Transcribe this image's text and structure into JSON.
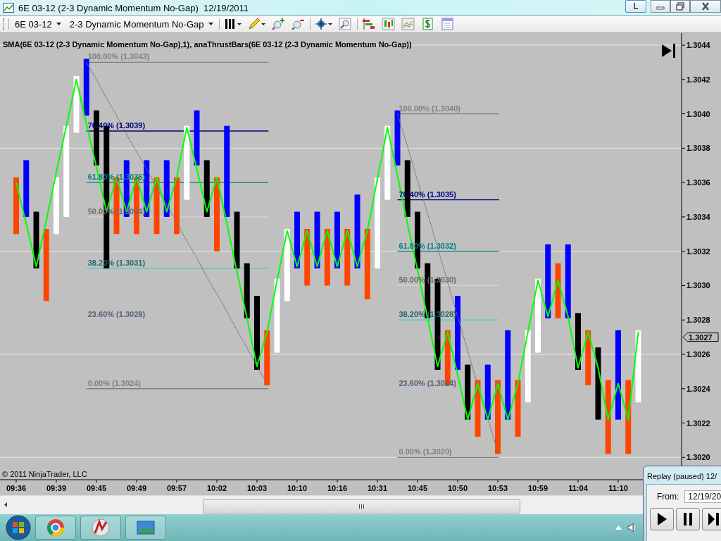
{
  "window": {
    "title": "6E 03-12 (2-3 Dynamic Momentum No-Gap)",
    "date": "12/19/2011",
    "layout_button": "L"
  },
  "toolbar": {
    "instrument": "6E 03-12",
    "bars_type": "2-3 Dynamic Momentum No-Gap"
  },
  "chart": {
    "legend": "SMA(6E 03-12 (2-3 Dynamic Momentum No-Gap),1), anaThrustBars(6E 03-12 (2-3 Dynamic Momentum No-Gap))",
    "copyright": "© 2011 NinjaTrader, LLC",
    "current_price": "1.3027",
    "chart_data": {
      "type": "candlestick",
      "grid": true,
      "ylim": [
        1.30187,
        1.30447
      ],
      "categories": [
        "09:36",
        null,
        null,
        null,
        "09:39",
        null,
        null,
        null,
        "09:45",
        null,
        null,
        null,
        "09:49",
        null,
        null,
        null,
        "09:57",
        null,
        null,
        null,
        "10:02",
        null,
        null,
        null,
        "10:03",
        null,
        null,
        null,
        "10:10",
        null,
        null,
        null,
        "10:16",
        null,
        null,
        null,
        "10:31",
        null,
        null,
        null,
        "10:45",
        null,
        null,
        null,
        "10:50",
        null,
        null,
        null,
        "10:53",
        null,
        null,
        null,
        "10:59",
        null,
        null,
        null,
        "11:04",
        null,
        null,
        null,
        "11:10",
        null,
        null
      ],
      "yticks": [
        {
          "value": 1.3044,
          "label": "1.3044"
        },
        {
          "value": 1.3042,
          "label": "1.3042"
        },
        {
          "value": 1.304,
          "label": "1.3040"
        },
        {
          "value": 1.3038,
          "label": "1.3038"
        },
        {
          "value": 1.3036,
          "label": "1.3036"
        },
        {
          "value": 1.3034,
          "label": "1.3034"
        },
        {
          "value": 1.3032,
          "label": "1.3032"
        },
        {
          "value": 1.303,
          "label": "1.3030"
        },
        {
          "value": 1.3028,
          "label": "1.3028"
        },
        {
          "value": 1.3026,
          "label": "1.3026"
        },
        {
          "value": 1.3024,
          "label": "1.3024"
        },
        {
          "value": 1.3022,
          "label": "1.3022"
        },
        {
          "value": 1.302,
          "label": "1.3020"
        }
      ],
      "series": [
        {
          "color": "#ff4500",
          "ohlc": [
            [
              1.30363,
              1.30363,
              1.3033,
              1.3033
            ],
            null,
            null,
            [
              1.30333,
              1.30333,
              1.30291,
              1.30291
            ],
            null,
            null,
            null,
            null,
            null,
            null,
            [
              1.30363,
              1.30363,
              1.3033,
              1.3033
            ],
            null,
            [
              1.30363,
              1.30363,
              1.3033,
              1.3033
            ],
            null,
            [
              1.30363,
              1.30363,
              1.3033,
              1.3033
            ],
            null,
            [
              1.30363,
              1.30363,
              1.3033,
              1.3033
            ],
            null,
            null,
            null,
            [
              1.30363,
              1.30363,
              1.3032,
              1.3032
            ],
            null,
            null,
            null,
            null,
            [
              1.30274,
              1.30274,
              1.30242,
              1.30242
            ],
            null,
            null,
            null,
            [
              1.30333,
              1.30333,
              1.303,
              1.303
            ],
            null,
            [
              1.30333,
              1.30333,
              1.303,
              1.303
            ],
            null,
            [
              1.30333,
              1.30333,
              1.303,
              1.303
            ],
            null,
            [
              1.30333,
              1.30333,
              1.30292,
              1.30292
            ],
            null,
            null,
            null,
            null,
            null,
            null,
            null,
            [
              1.30274,
              1.30274,
              1.30242,
              1.30242
            ],
            null,
            null,
            [
              1.30245,
              1.30245,
              1.30212,
              1.30212
            ],
            null,
            [
              1.30245,
              1.30245,
              1.30202,
              1.30202
            ],
            null,
            [
              1.30245,
              1.30245,
              1.30212,
              1.30212
            ],
            null,
            null,
            null,
            [
              1.30313,
              1.30313,
              1.30281,
              1.30281
            ],
            null,
            null,
            [
              1.30274,
              1.30274,
              1.30242,
              1.30242
            ],
            null,
            [
              1.30245,
              1.30245,
              1.30202,
              1.30202
            ],
            null,
            [
              1.30245,
              1.30245,
              1.30202,
              1.30202
            ],
            null
          ]
        },
        {
          "color": "#0000ff",
          "ohlc": [
            null,
            [
              1.3034,
              1.30373,
              1.3034,
              1.30373
            ],
            null,
            null,
            null,
            null,
            null,
            [
              1.30399,
              1.30432,
              1.30399,
              1.30432
            ],
            null,
            null,
            null,
            [
              1.3034,
              1.30373,
              1.3034,
              1.30373
            ],
            null,
            [
              1.3034,
              1.30373,
              1.3034,
              1.30373
            ],
            null,
            [
              1.3034,
              1.30373,
              1.3034,
              1.30373
            ],
            null,
            null,
            [
              1.3037,
              1.30402,
              1.3037,
              1.30402
            ],
            null,
            null,
            [
              1.3034,
              1.30393,
              1.3034,
              1.30393
            ],
            null,
            null,
            null,
            null,
            null,
            null,
            [
              1.3031,
              1.30343,
              1.3031,
              1.30343
            ],
            null,
            [
              1.3031,
              1.30343,
              1.3031,
              1.30343
            ],
            null,
            [
              1.3031,
              1.30343,
              1.3031,
              1.30343
            ],
            null,
            [
              1.3031,
              1.30353,
              1.3031,
              1.30353
            ],
            null,
            null,
            null,
            [
              1.3037,
              1.30402,
              1.3037,
              1.30402
            ],
            null,
            null,
            null,
            null,
            null,
            [
              1.30251,
              1.30294,
              1.30251,
              1.30294
            ],
            null,
            null,
            [
              1.30222,
              1.30254,
              1.30222,
              1.30254
            ],
            null,
            [
              1.30222,
              1.30274,
              1.30222,
              1.30274
            ],
            null,
            null,
            null,
            [
              1.30281,
              1.30324,
              1.30281,
              1.30324
            ],
            null,
            [
              1.30281,
              1.30324,
              1.30281,
              1.30324
            ],
            null,
            null,
            null,
            null,
            [
              1.30222,
              1.30274,
              1.30222,
              1.30274
            ],
            null,
            null
          ]
        },
        {
          "color": "#000000",
          "ohlc": [
            null,
            null,
            [
              1.30343,
              1.30343,
              1.3031,
              1.3031
            ],
            null,
            null,
            null,
            null,
            null,
            [
              1.30402,
              1.30402,
              1.3037,
              1.3037
            ],
            [
              1.30393,
              1.30393,
              1.3031,
              1.3031
            ],
            null,
            null,
            null,
            null,
            null,
            null,
            null,
            null,
            null,
            [
              1.30373,
              1.30373,
              1.3034,
              1.3034
            ],
            null,
            null,
            [
              1.30343,
              1.30343,
              1.3031,
              1.3031
            ],
            [
              1.30313,
              1.30313,
              1.30281,
              1.30281
            ],
            [
              1.30294,
              1.30294,
              1.30251,
              1.30251
            ],
            null,
            null,
            null,
            null,
            null,
            null,
            null,
            null,
            null,
            null,
            null,
            null,
            null,
            null,
            [
              1.30373,
              1.30373,
              1.3034,
              1.3034
            ],
            [
              1.30343,
              1.30343,
              1.3031,
              1.3031
            ],
            [
              1.30313,
              1.30313,
              1.30281,
              1.30281
            ],
            [
              1.30304,
              1.30304,
              1.30251,
              1.30251
            ],
            null,
            null,
            [
              1.30254,
              1.30254,
              1.30222,
              1.30222
            ],
            null,
            null,
            null,
            null,
            null,
            null,
            null,
            null,
            null,
            null,
            [
              1.30284,
              1.30284,
              1.30251,
              1.30251
            ],
            null,
            [
              1.30264,
              1.30264,
              1.30222,
              1.30222
            ],
            null,
            null,
            null,
            null
          ]
        },
        {
          "color": "#ffffff",
          "ohlc": [
            null,
            null,
            null,
            null,
            [
              1.3033,
              1.30363,
              1.3033,
              1.30363
            ],
            [
              1.3034,
              1.30393,
              1.3034,
              1.30393
            ],
            [
              1.30389,
              1.30422,
              1.30389,
              1.30422
            ],
            null,
            null,
            null,
            null,
            null,
            null,
            null,
            null,
            null,
            null,
            [
              1.3035,
              1.30393,
              1.3035,
              1.30393
            ],
            null,
            null,
            null,
            null,
            null,
            null,
            null,
            null,
            [
              1.30261,
              1.30304,
              1.30261,
              1.30304
            ],
            [
              1.30291,
              1.30333,
              1.30291,
              1.30333
            ],
            null,
            null,
            null,
            null,
            null,
            null,
            null,
            null,
            [
              1.3031,
              1.30363,
              1.3031,
              1.30363
            ],
            [
              1.3035,
              1.30393,
              1.3035,
              1.30393
            ],
            null,
            null,
            null,
            null,
            null,
            null,
            null,
            null,
            null,
            null,
            null,
            null,
            null,
            [
              1.30232,
              1.30274,
              1.30232,
              1.30274
            ],
            [
              1.30261,
              1.30304,
              1.30261,
              1.30304
            ],
            null,
            null,
            null,
            null,
            null,
            null,
            null,
            null,
            null,
            [
              1.30232,
              1.30274,
              1.30232,
              1.30274
            ]
          ]
        },
        {
          "type": "line",
          "color": "#707070",
          "line_style": "dashed",
          "values": [
            null,
            null,
            null,
            null,
            null,
            null,
            null,
            1.3043,
            1.3042,
            1.30409,
            1.30399,
            1.30388,
            1.30378,
            1.30368,
            1.30357,
            1.30347,
            1.30337,
            1.30326,
            1.30316,
            1.30305,
            1.30295,
            1.30285,
            1.30274,
            1.30264,
            1.30253,
            1.30243,
            null,
            null,
            null,
            null,
            null,
            null,
            null,
            null,
            null,
            null,
            null,
            null,
            1.304,
            1.30381,
            1.30361,
            1.30342,
            1.30322,
            1.30302,
            1.30282,
            1.30262,
            1.30242,
            1.30223,
            1.30203,
            null,
            null,
            null,
            null,
            null,
            null,
            null,
            null,
            null,
            null,
            null,
            null,
            null,
            null
          ]
        },
        {
          "type": "line",
          "color": "#00ff00",
          "line_style": "solid",
          "values": [
            1.3036,
            1.30336,
            1.30311,
            1.30338,
            1.30366,
            1.30393,
            1.3042,
            1.30394,
            1.30369,
            1.30343,
            1.30363,
            1.30343,
            1.30363,
            1.30343,
            1.30363,
            1.30343,
            1.30363,
            1.30392,
            1.30368,
            1.30343,
            1.30363,
            1.30336,
            1.30308,
            1.30281,
            1.30253,
            1.30273,
            1.30303,
            1.30332,
            1.30311,
            1.30332,
            1.30311,
            1.30332,
            1.30311,
            1.30332,
            1.30311,
            1.30332,
            1.30362,
            1.30392,
            1.30364,
            1.30336,
            1.30309,
            1.30281,
            1.30253,
            1.30273,
            1.30248,
            1.30222,
            1.30243,
            1.30222,
            1.30243,
            1.30222,
            1.30243,
            1.30273,
            1.30303,
            1.30282,
            1.30303,
            1.30282,
            1.30252,
            1.30273,
            1.30252,
            1.30222,
            1.30243,
            1.30222,
            1.30273
          ]
        }
      ],
      "ref_lines": [
        {
          "axis": "y",
          "value": 1.3043,
          "label": "100.00% (1.3043)",
          "color": "#808080"
        },
        {
          "axis": "y",
          "value": 1.3039,
          "label": "76.40% (1.3039)",
          "color": "#000080"
        },
        {
          "axis": "y",
          "value": 1.3036,
          "label": "61.80% (1.3036)",
          "color": "#008080"
        },
        {
          "axis": "y",
          "value": 1.3034,
          "label": "50.00% (1.3034)",
          "color": "#d3d3d3"
        },
        {
          "axis": "y",
          "value": 1.3031,
          "label": "38.20% (1.3031)",
          "color": "#48d1cc"
        },
        {
          "axis": "y",
          "value": 1.3028,
          "label": "23.60% (1.3028)",
          "color": "#b0c4de"
        },
        {
          "axis": "y",
          "value": 1.3024,
          "label": "0.00% (1.3024)",
          "color": "#808080"
        },
        {
          "axis": "y",
          "value": 1.304,
          "label": "100.00% (1.3040)",
          "color": "#808080"
        },
        {
          "axis": "y",
          "value": 1.3035,
          "label": "76.40% (1.3035)",
          "color": "#000080"
        },
        {
          "axis": "y",
          "value": 1.3032,
          "label": "61.80% (1.3032)",
          "color": "#008080"
        },
        {
          "axis": "y",
          "value": 1.303,
          "label": "50.00% (1.3030)",
          "color": "#d3d3d3"
        },
        {
          "axis": "y",
          "value": 1.3028,
          "label": "38.20% (1.3028)",
          "color": "#48d1cc"
        },
        {
          "axis": "y",
          "value": 1.3024,
          "label": "23.60% (1.3024)",
          "color": "#b0c4de"
        },
        {
          "axis": "y",
          "value": 1.302,
          "label": "0.00% (1.3020)",
          "color": "#808080"
        }
      ]
    }
  },
  "replay": {
    "title": "Replay (paused) 12/",
    "from_label": "From:",
    "from_value": "12/19/20"
  }
}
